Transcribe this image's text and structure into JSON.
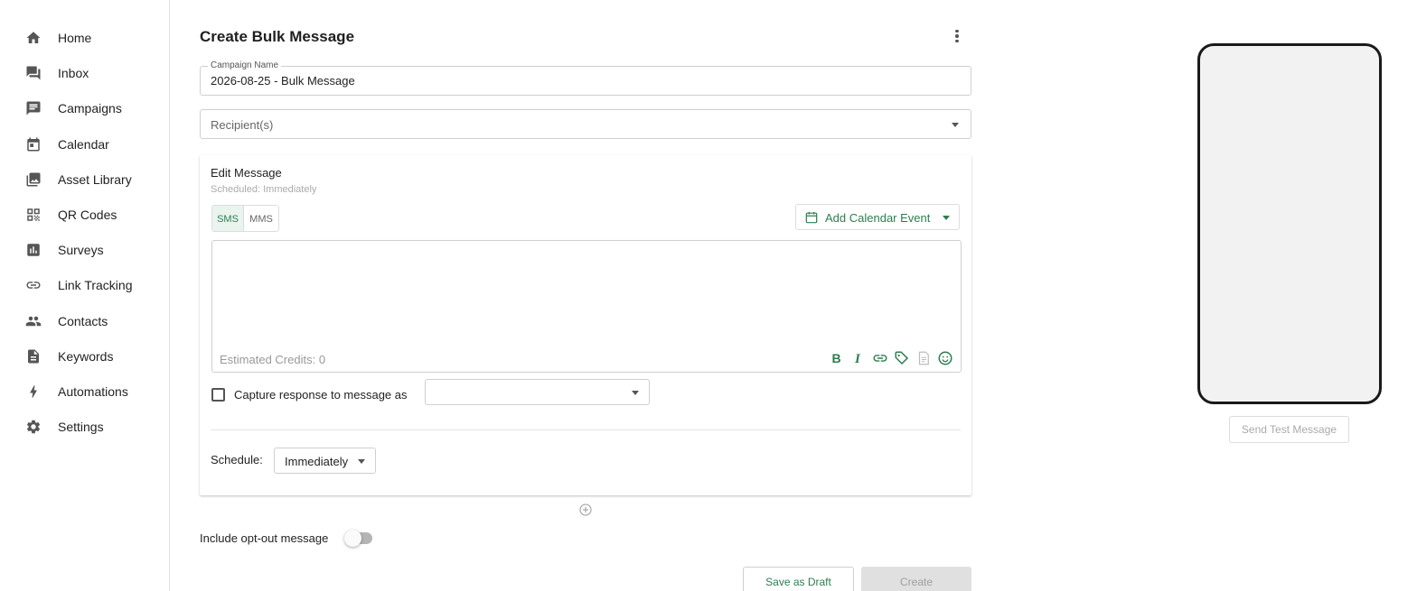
{
  "sidebar": {
    "items": [
      {
        "label": "Home",
        "icon": "home-icon"
      },
      {
        "label": "Inbox",
        "icon": "inbox-icon"
      },
      {
        "label": "Campaigns",
        "icon": "campaigns-icon"
      },
      {
        "label": "Calendar",
        "icon": "calendar-icon"
      },
      {
        "label": "Asset Library",
        "icon": "asset-library-icon"
      },
      {
        "label": "QR Codes",
        "icon": "qr-code-icon"
      },
      {
        "label": "Surveys",
        "icon": "surveys-icon"
      },
      {
        "label": "Link Tracking",
        "icon": "link-icon"
      },
      {
        "label": "Contacts",
        "icon": "contacts-icon"
      },
      {
        "label": "Keywords",
        "icon": "keywords-icon"
      },
      {
        "label": "Automations",
        "icon": "automations-icon"
      },
      {
        "label": "Settings",
        "icon": "settings-icon"
      }
    ]
  },
  "header": {
    "title": "Create Bulk Message"
  },
  "form": {
    "campaign_name_label": "Campaign Name",
    "campaign_name_value": "2026-08-25 - Bulk Message",
    "recipients_placeholder": "Recipient(s)"
  },
  "editor": {
    "heading": "Edit Message",
    "scheduled_subtitle": "Scheduled: Immediately",
    "tab_sms": "SMS",
    "tab_mms": "MMS",
    "active_tab": "SMS",
    "add_calendar_event": "Add Calendar Event",
    "estimated_credits": "Estimated Credits: 0",
    "toolbar_icons": [
      "bold-icon",
      "italic-icon",
      "link-icon",
      "tag-icon",
      "template-icon",
      "emoji-icon"
    ],
    "capture_label": "Capture response to message as",
    "capture_checked": false,
    "schedule_label": "Schedule:",
    "schedule_value": "Immediately"
  },
  "footer": {
    "optout_label": "Include opt-out message",
    "optout_enabled": false,
    "save_draft": "Save as Draft",
    "create": "Create"
  },
  "preview": {
    "send_test": "Send Test Message"
  },
  "colors": {
    "accent": "#2e7d4f",
    "accent_light": "#eaf4ee",
    "disabled_bg": "#e0e0e0"
  }
}
